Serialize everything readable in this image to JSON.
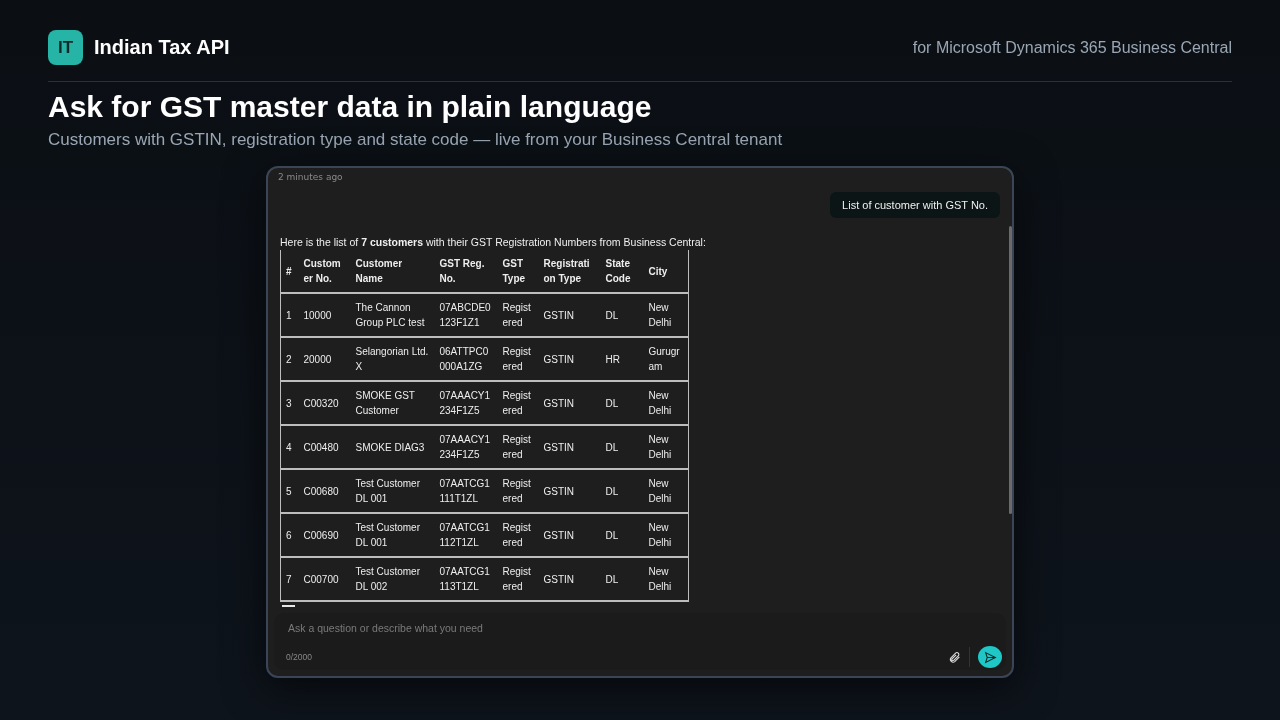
{
  "header": {
    "logo": "IT",
    "title": "Indian Tax API",
    "tagline": "for Microsoft Dynamics 365 Business Central"
  },
  "headline": "Ask for GST master data in plain language",
  "subheadline": "Customers with GSTIN, registration type and state code — live from your Business Central tenant",
  "chat": {
    "timestamp": "2 minutes ago",
    "user_message": "List of customer with GST No.",
    "reply_intro": "Here is the list of **7 customers** with their GST Registration Numbers from Business Central:",
    "table": {
      "columns": [
        "#",
        "Customer No.",
        "Customer Name",
        "GST Reg. No.",
        "GST Type",
        "Registration Type",
        "State Code",
        "City"
      ],
      "rows": [
        [
          "1",
          "10000",
          "The Cannon Group PLC test",
          "07ABCDE0123F1Z1",
          "Registered",
          "GSTIN",
          "DL",
          "New Delhi"
        ],
        [
          "2",
          "20000",
          "Selangorian Ltd. X",
          "06ATTPC0000A1ZG",
          "Registered",
          "GSTIN",
          "HR",
          "Gurugram"
        ],
        [
          "3",
          "C00320",
          "SMOKE GST Customer",
          "07AAACY1234F1Z5",
          "Registered",
          "GSTIN",
          "DL",
          "New Delhi"
        ],
        [
          "4",
          "C00480",
          "SMOKE DIAG3",
          "07AAACY1234F1Z5",
          "Registered",
          "GSTIN",
          "DL",
          "New Delhi"
        ],
        [
          "5",
          "C00680",
          "Test Customer DL 001",
          "07AATCG1111T1ZL",
          "Registered",
          "GSTIN",
          "DL",
          "New Delhi"
        ],
        [
          "6",
          "C00690",
          "Test Customer DL 001",
          "07AATCG1112T1ZL",
          "Registered",
          "GSTIN",
          "DL",
          "New Delhi"
        ],
        [
          "7",
          "C00700",
          "Test Customer DL 002",
          "07AATCG1113T1ZL",
          "Registered",
          "GSTIN",
          "DL",
          "New Delhi"
        ]
      ]
    },
    "input": {
      "placeholder": "Ask a question or describe what you need",
      "counter": "0/2000"
    }
  }
}
